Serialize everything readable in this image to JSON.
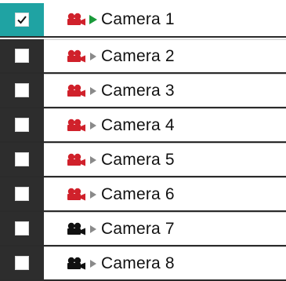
{
  "colors": {
    "selected_bg": "#1fa3a3",
    "row_bg": "#2d2d2d",
    "active_camera": "#d0212b",
    "inactive_camera": "#111111",
    "play_active": "#1a9a3a",
    "play_inactive": "#8a8a8a"
  },
  "cameras": [
    {
      "label": "Camera 1",
      "checked": true,
      "selected": true,
      "camera_icon": "camera-red-icon",
      "play_icon": "play-green-icon"
    },
    {
      "label": "Camera 2",
      "checked": false,
      "selected": false,
      "camera_icon": "camera-red-icon",
      "play_icon": "play-gray-icon"
    },
    {
      "label": "Camera 3",
      "checked": false,
      "selected": false,
      "camera_icon": "camera-red-icon",
      "play_icon": "play-gray-icon"
    },
    {
      "label": "Camera 4",
      "checked": false,
      "selected": false,
      "camera_icon": "camera-red-icon",
      "play_icon": "play-gray-icon"
    },
    {
      "label": "Camera 5",
      "checked": false,
      "selected": false,
      "camera_icon": "camera-red-icon",
      "play_icon": "play-gray-icon"
    },
    {
      "label": "Camera 6",
      "checked": false,
      "selected": false,
      "camera_icon": "camera-red-icon",
      "play_icon": "play-gray-icon"
    },
    {
      "label": "Camera 7",
      "checked": false,
      "selected": false,
      "camera_icon": "camera-black-icon",
      "play_icon": "play-gray-icon"
    },
    {
      "label": "Camera 8",
      "checked": false,
      "selected": false,
      "camera_icon": "camera-black-icon",
      "play_icon": "play-gray-icon"
    }
  ]
}
